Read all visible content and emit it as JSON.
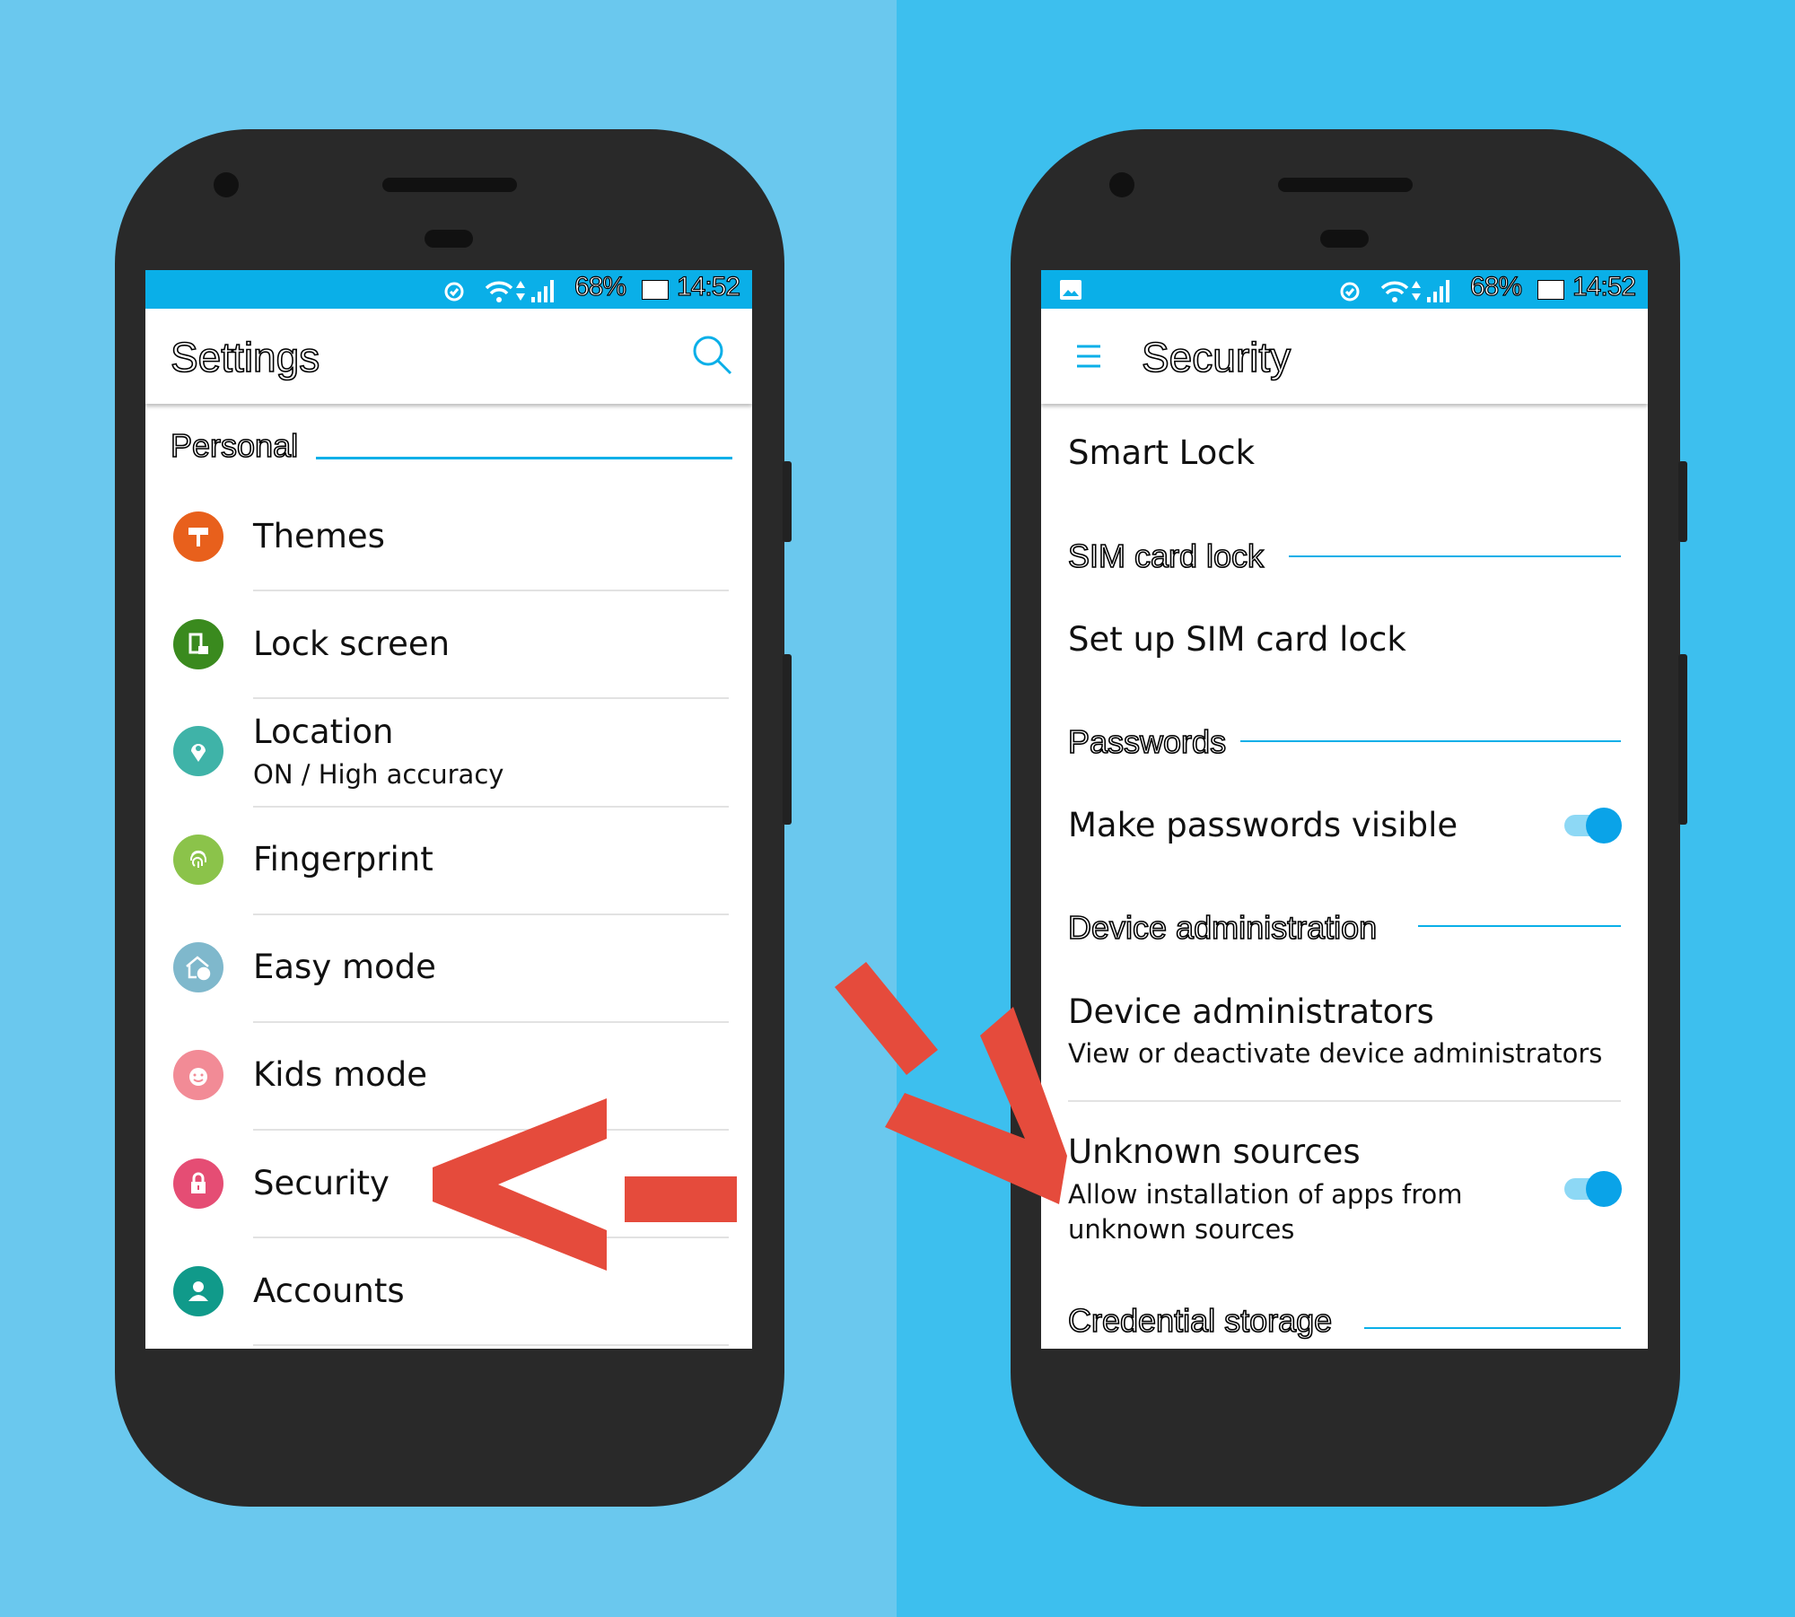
{
  "status_bar": {
    "battery": "68%",
    "time": "14:52",
    "icons": [
      "alarm-icon",
      "wifi-icon",
      "data-arrows-icon",
      "signal-icon",
      "battery-icon"
    ],
    "right_extra_icon": "image-icon"
  },
  "settings": {
    "title": "Settings",
    "search_icon": "search-icon",
    "section": "Personal",
    "items": [
      {
        "label": "Themes",
        "icon": "paint-roller-icon",
        "color": "#e8601c"
      },
      {
        "label": "Lock screen",
        "icon": "lock-screen-icon",
        "color": "#3a8a1e"
      },
      {
        "label": "Location",
        "sublabel": "ON / High accuracy",
        "icon": "location-pin-icon",
        "color": "#3fb3a8"
      },
      {
        "label": "Fingerprint",
        "icon": "fingerprint-icon",
        "color": "#8bc34a"
      },
      {
        "label": "Easy mode",
        "icon": "easy-mode-house-icon",
        "color": "#7fb8cc"
      },
      {
        "label": "Kids mode",
        "icon": "kid-face-icon",
        "color": "#f28b96"
      },
      {
        "label": "Security",
        "icon": "padlock-icon",
        "color": "#e54d74"
      },
      {
        "label": "Accounts",
        "icon": "person-icon",
        "color": "#109a8a"
      }
    ]
  },
  "security": {
    "title": "Security",
    "menu_icon": "hamburger-menu-icon",
    "smart_lock": "Smart Lock",
    "sim_header": "SIM card lock",
    "sim_item": "Set up SIM card lock",
    "passwords_header": "Passwords",
    "passwords_item": "Make passwords visible",
    "passwords_toggle_on": true,
    "device_header": "Device administration",
    "device_item": "Device administrators",
    "device_sub": "View or deactivate device administrators",
    "unknown_item": "Unknown sources",
    "unknown_sub1": "Allow installation of apps from",
    "unknown_sub2": "unknown sources",
    "unknown_toggle_on": true,
    "credential_header": "Credential storage"
  },
  "colors": {
    "accent": "#0aafe8",
    "arrow": "#e54b3c",
    "bg_left": "#6ac8ee",
    "bg_right": "#3dbfee"
  }
}
